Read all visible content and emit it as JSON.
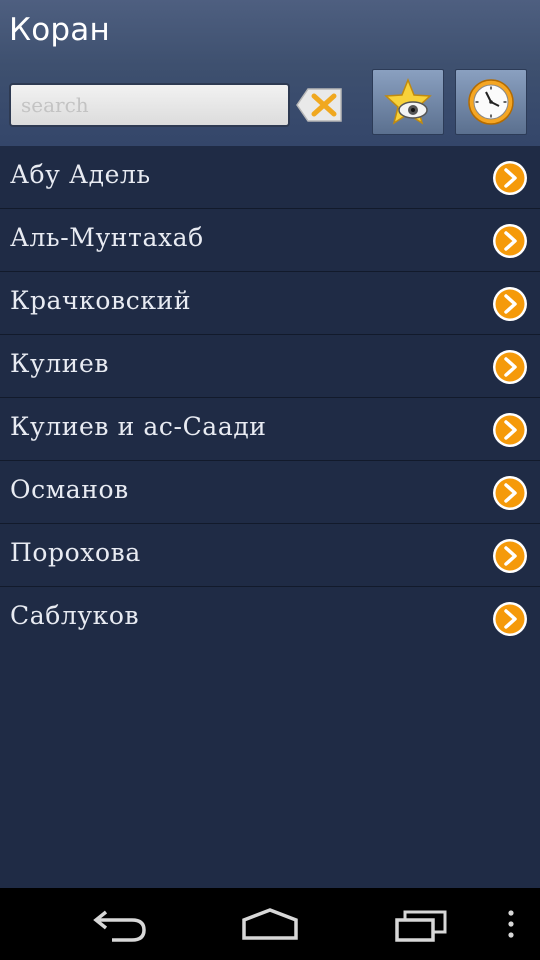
{
  "header": {
    "title": "Коран",
    "search": {
      "placeholder": "search",
      "value": ""
    }
  },
  "list": {
    "items": [
      {
        "label": "Абу Адель"
      },
      {
        "label": "Аль-Мунтахаб"
      },
      {
        "label": "Крачковский"
      },
      {
        "label": "Кулиев"
      },
      {
        "label": "Кулиев и ас-Саади"
      },
      {
        "label": "Османов"
      },
      {
        "label": "Порохова"
      },
      {
        "label": "Саблуков"
      }
    ]
  },
  "icons": {
    "clear": "clear-x-icon",
    "favorites": "star-eye-icon",
    "history": "clock-icon",
    "row_arrow": "chevron-right-icon",
    "nav_back": "back-arrow-icon",
    "nav_home": "home-icon",
    "nav_recent": "recent-apps-icon",
    "nav_menu": "overflow-menu-icon"
  },
  "colors": {
    "background": "#1f2b45",
    "header": "#3e506f",
    "accent": "#f59a0a",
    "text": "#e8ebf2"
  }
}
